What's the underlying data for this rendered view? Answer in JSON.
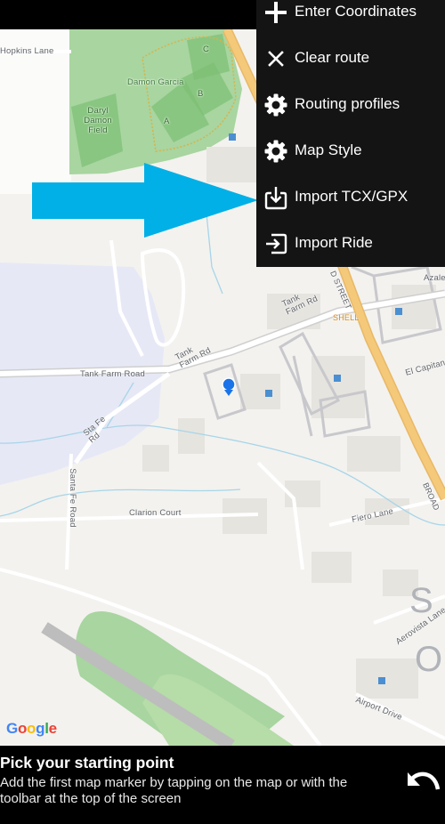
{
  "menu": {
    "items": [
      {
        "label": "Enter Coordinates",
        "icon": "plus-icon"
      },
      {
        "label": "Clear route",
        "icon": "close-icon"
      },
      {
        "label": "Routing profiles",
        "icon": "gear-icon"
      },
      {
        "label": "Map Style",
        "icon": "gear-icon"
      },
      {
        "label": "Import TCX/GPX",
        "icon": "import-icon"
      },
      {
        "label": "Import Ride",
        "icon": "login-arrow-icon"
      }
    ]
  },
  "map": {
    "labels": {
      "hopkins_lane": "Hopkins Lane",
      "damon_garcia": "Damon Garcia",
      "field_c": "C",
      "field_b": "B",
      "field_a": "A",
      "daryl_damon_field": "Daryl Damon Field",
      "tank_farm_road_w": "Tank Farm Road",
      "tank_farm_rd_mid": "Tank Farm Rd",
      "tank_farm_rd_ne": "Tank Farm Rd",
      "sta_fe_rd": "Sta Fe Rd",
      "santa_fe_road": "Santa Fe Road",
      "clarion_court": "Clarion Court",
      "fiero_lane": "Fiero Lane",
      "el_capitan": "El Capitan",
      "azalea": "Azale",
      "broad_street": "D STREET",
      "broad": "BROAD",
      "shell": "SHELL",
      "aerovista": "Aerovista Lane",
      "airport_drive": "Airport Drive",
      "area_letter_s": "S",
      "area_letter_o": "O"
    },
    "attribution": "Google"
  },
  "bottom": {
    "title": "Pick your starting point",
    "description": "Add the first map marker by tapping on the map or with the toolbar at the top of the screen"
  },
  "colors": {
    "accent_arrow": "#00b0e6",
    "menu_bg": "#141414",
    "park": "#a8d5a0",
    "water": "#e5e7f5",
    "road_major": "#f5c97a",
    "marker": "#1a73e8"
  }
}
